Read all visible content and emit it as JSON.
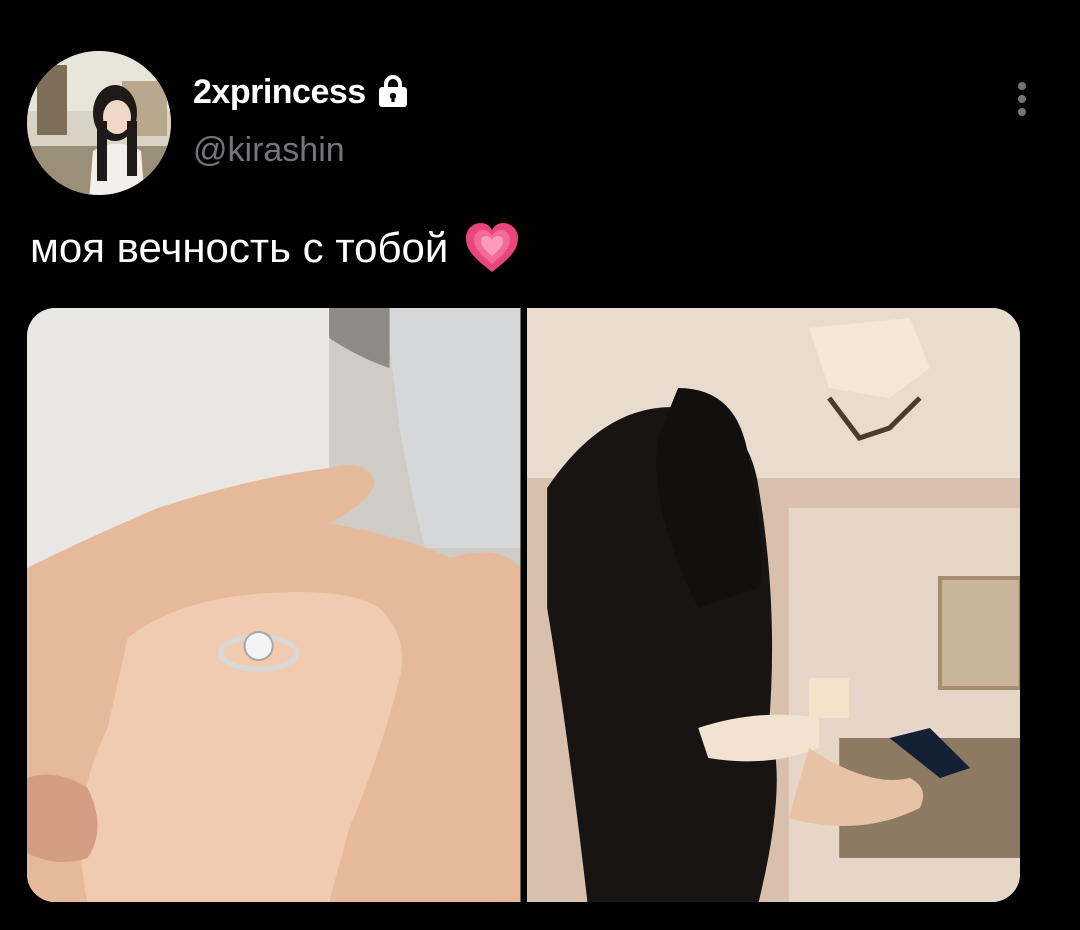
{
  "author": {
    "display_name": "2xprincess",
    "handle": "@kirashin",
    "avatar_icon": "profile-photo",
    "protected_icon": "lock-icon"
  },
  "tweet": {
    "text": "моя вечность с тобой",
    "emoji_icon": "growing-heart-icon"
  },
  "menu": {
    "icon": "more-vertical-icon"
  },
  "media": {
    "photos": [
      {
        "name": "photo-hands-ring",
        "icon": "image"
      },
      {
        "name": "photo-couple-embrace",
        "icon": "image"
      }
    ]
  },
  "colors": {
    "background": "#000000",
    "text_primary": "#ffffff",
    "text_secondary": "#71767b",
    "heart": "#f0477f"
  }
}
